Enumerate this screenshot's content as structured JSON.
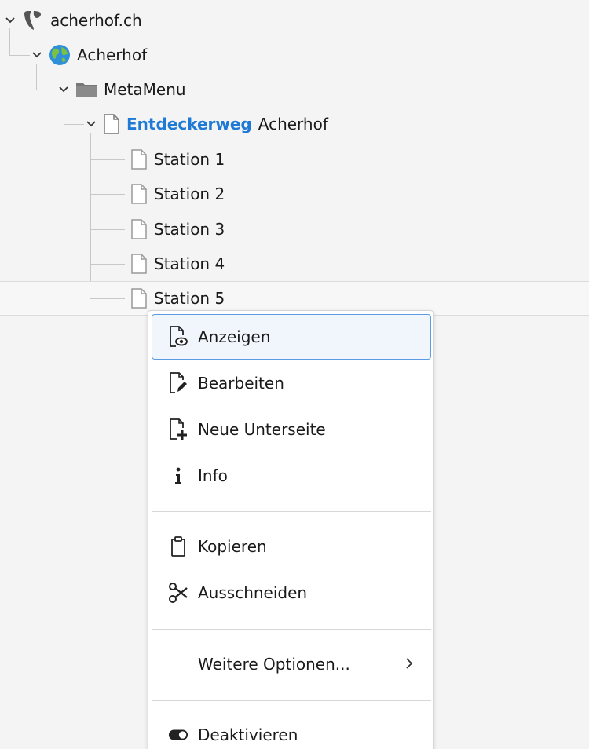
{
  "tree": {
    "root": "acherhof.ch",
    "site": "Acherhof",
    "folder": "MetaMenu",
    "page_highlight": "Entdeckerweg",
    "page_rest": "Acherhof",
    "stations": [
      "Station 1",
      "Station 2",
      "Station 3",
      "Station 4",
      "Station 5"
    ]
  },
  "context_menu": {
    "items": {
      "show": "Anzeigen",
      "edit": "Bearbeiten",
      "new_subpage": "Neue Unterseite",
      "info": "Info",
      "copy": "Kopieren",
      "cut": "Ausschneiden",
      "more_options": "Weitere Optionen...",
      "deactivate": "Deaktivieren"
    }
  },
  "colors": {
    "highlight": "#1f7ad6",
    "active_border": "#5b9be3",
    "active_bg": "#f1f6fd"
  }
}
